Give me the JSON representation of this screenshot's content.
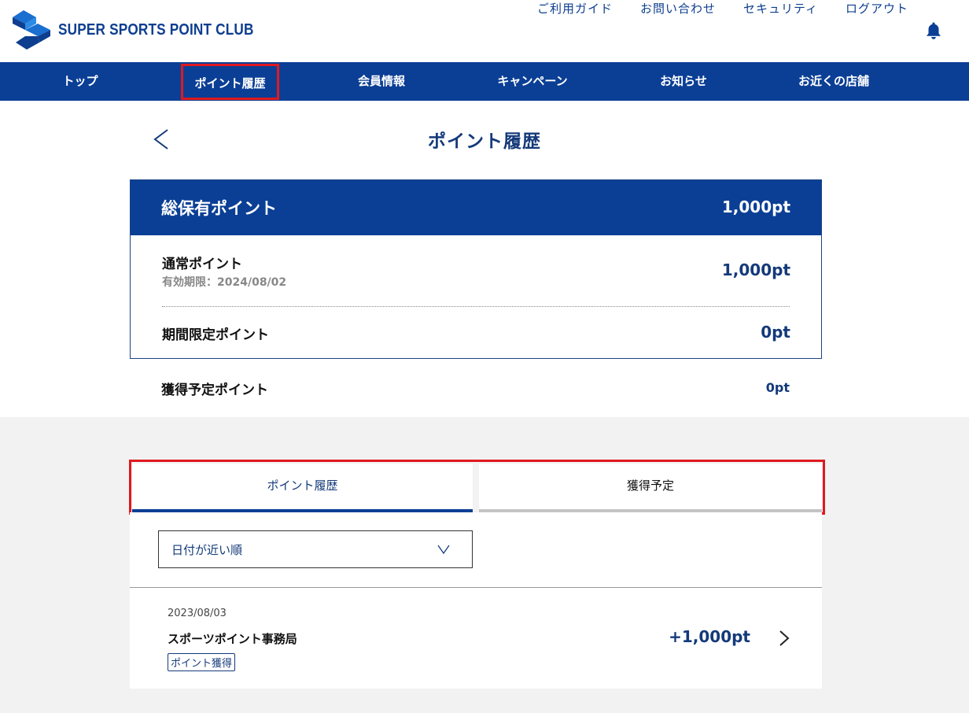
{
  "header": {
    "logo_text": "SUPER SPORTS POINT CLUB",
    "util_links": [
      "ご利用ガイド",
      "お問い合わせ",
      "セキュリティ",
      "ログアウト"
    ],
    "bell_icon": "bell-icon"
  },
  "nav": {
    "items": [
      "トップ",
      "ポイント履歴",
      "会員情報",
      "キャンペーン",
      "お知らせ",
      "お近くの店舗"
    ]
  },
  "page": {
    "title": "ポイント履歴"
  },
  "points": {
    "total_label": "総保有ポイント",
    "total_value": "1,000pt",
    "regular_label": "通常ポイント",
    "regular_expiry": "有効期限：2024/08/02",
    "regular_value": "1,000pt",
    "limited_label": "期間限定ポイント",
    "limited_value": "0pt",
    "pending_label": "獲得予定ポイント",
    "pending_value": "0pt"
  },
  "tabs": {
    "history": "ポイント履歴",
    "scheduled": "獲得予定"
  },
  "sort": {
    "selected": "日付が近い順"
  },
  "history": [
    {
      "date": "2023/08/03",
      "name": "スポーツポイント事務局",
      "badge": "ポイント獲得",
      "amount": "+1,000pt"
    }
  ],
  "colors": {
    "brand": "#0b3f95",
    "brand_text": "#143a7a",
    "highlight": "#e0191f"
  }
}
